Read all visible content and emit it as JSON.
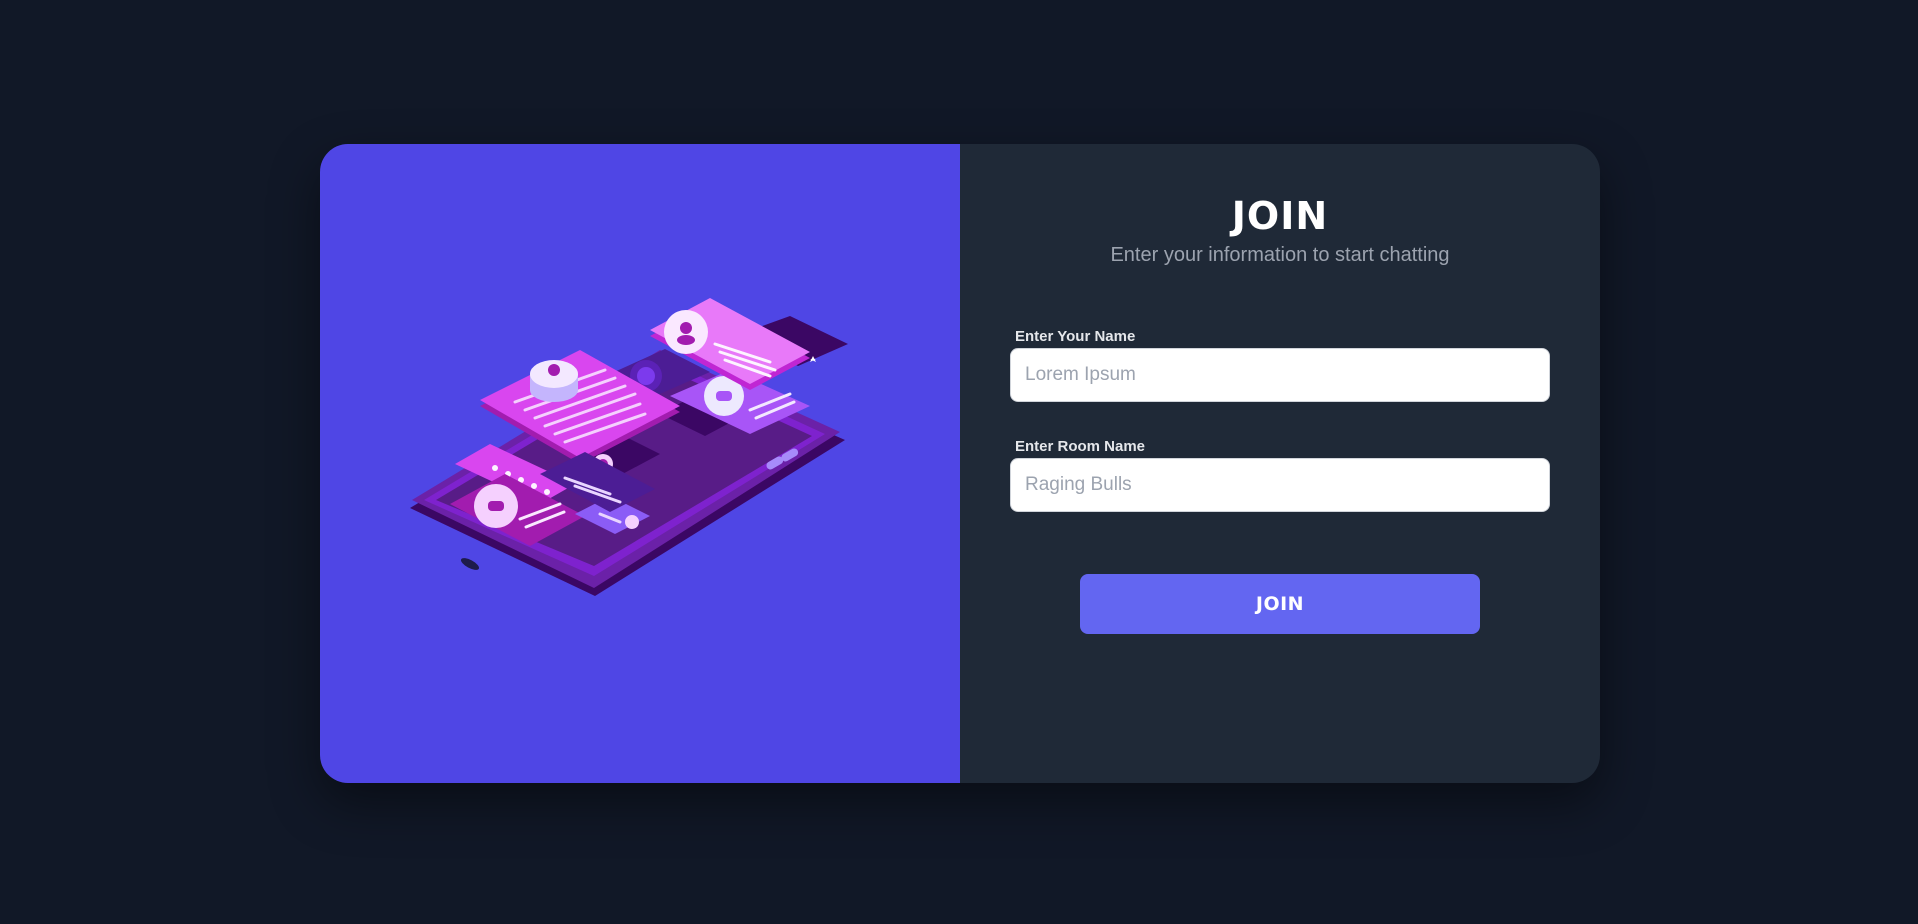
{
  "form": {
    "title": "JOIN",
    "subtitle": "Enter your information to start chatting",
    "name_label": "Enter Your Name",
    "name_placeholder": "Lorem Ipsum",
    "name_value": "",
    "room_label": "Enter Room Name",
    "room_placeholder": "Raging Bulls",
    "room_value": "",
    "join_label": "JOIN"
  },
  "colors": {
    "page_background": "#111827",
    "illustration_panel": "#4f46e5",
    "form_panel": "#1f2937",
    "button": "#6366f1"
  },
  "illustration": {
    "icons": [
      "phone-illustration",
      "chat-bubble-icon",
      "user-avatar-icon",
      "star-rating-icon",
      "smiley-icon"
    ]
  }
}
